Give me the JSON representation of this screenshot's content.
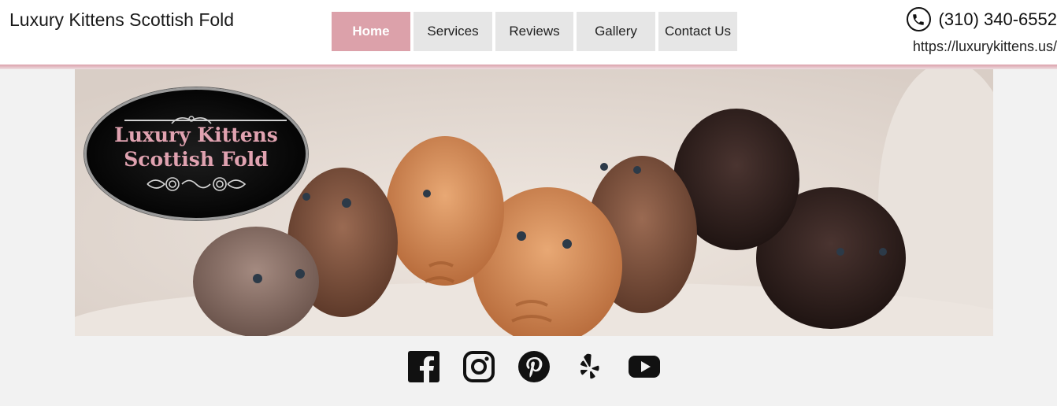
{
  "header": {
    "brand": "Luxury Kittens Scottish Fold",
    "phone": "(310) 340-6552",
    "url": "https://luxurykittens.us/"
  },
  "nav": {
    "items": [
      {
        "label": "Home",
        "active": true
      },
      {
        "label": "Services",
        "active": false
      },
      {
        "label": "Reviews",
        "active": false
      },
      {
        "label": "Gallery",
        "active": false
      },
      {
        "label": "Contact Us",
        "active": false
      }
    ]
  },
  "hero": {
    "logo_line1": "Luxury Kittens",
    "logo_line2": "Scottish Fold"
  },
  "social": {
    "icons": [
      "facebook-icon",
      "instagram-icon",
      "pinterest-icon",
      "yelp-icon",
      "youtube-icon"
    ]
  },
  "colors": {
    "accent": "#dca1aa",
    "nav_bg": "#e6e6e6",
    "page_bg": "#f2f2f2"
  }
}
